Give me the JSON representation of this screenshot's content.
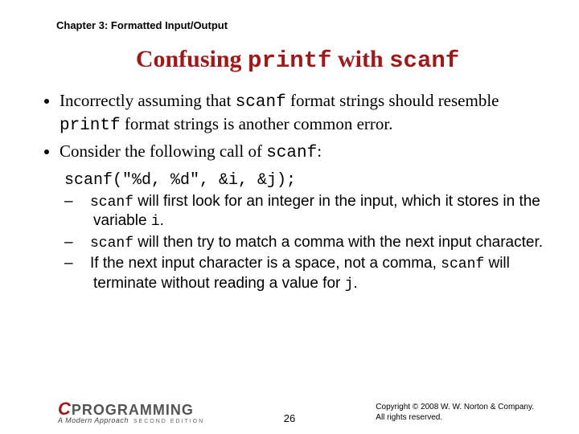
{
  "chapter": "Chapter 3: Formatted Input/Output",
  "title": {
    "pre": "Confusing ",
    "code1": "printf",
    "mid": " with ",
    "code2": "scanf"
  },
  "b1": {
    "t1": "Incorrectly assuming that ",
    "c1": "scanf",
    "t2": " format strings should resemble ",
    "c2": "printf",
    "t3": " format strings is another common error."
  },
  "b2": {
    "t1": "Consider the following call of ",
    "c1": "scanf",
    "t2": ":"
  },
  "codeline": "scanf(\"%d, %d\", &i, &j);",
  "s1": {
    "c1": "scanf",
    "t1": " will first look for an integer in the input, which it stores in the variable ",
    "c2": "i",
    "t2": "."
  },
  "s2": {
    "c1": "scanf",
    "t1": " will then try to match a comma with the next input character."
  },
  "s3": {
    "t1": "If the next input character is a space, not a comma, ",
    "c1": "scanf",
    "t2": " will terminate without reading a value for ",
    "c2": "j",
    "t3": "."
  },
  "logo": {
    "c": "C",
    "rest": "PROGRAMMING",
    "sub": "A Modern Approach",
    "ed": "SECOND EDITION"
  },
  "page": "26",
  "copy1": "Copyright © 2008 W. W. Norton & Company.",
  "copy2": "All rights reserved."
}
